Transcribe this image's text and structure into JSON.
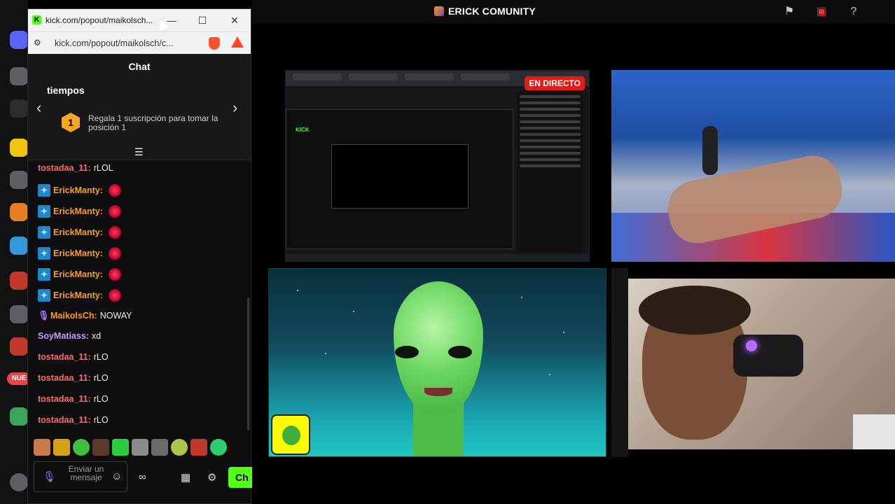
{
  "window": {
    "title": "kick.com/popout/maikolsch...",
    "url": "kick.com/popout/maikolsch/c..."
  },
  "chat": {
    "header": "Chat",
    "promo_heading": "tiempos",
    "promo_rank": "1",
    "promo_text": "Regala 1 suscripción para tomar la posición 1",
    "messages": [
      {
        "user": "tostadaa_11",
        "text": "rLOL",
        "badge": false,
        "emote": false,
        "style": "red"
      },
      {
        "user": "ErickManty",
        "text": "",
        "badge": true,
        "emote": true,
        "style": "orange"
      },
      {
        "user": "ErickManty",
        "text": "",
        "badge": true,
        "emote": true,
        "style": "orange"
      },
      {
        "user": "ErickManty",
        "text": "",
        "badge": true,
        "emote": true,
        "style": "orange"
      },
      {
        "user": "ErickManty",
        "text": "",
        "badge": true,
        "emote": true,
        "style": "orange"
      },
      {
        "user": "ErickManty",
        "text": "",
        "badge": true,
        "emote": true,
        "style": "orange"
      },
      {
        "user": "ErickManty",
        "text": "",
        "badge": true,
        "emote": true,
        "style": "orange"
      },
      {
        "user": "MaikolsCh",
        "text": "NOWAY",
        "badge": false,
        "mic": true,
        "emote": false,
        "style": "orange"
      },
      {
        "user": "SoyMatiass",
        "text": "xd",
        "badge": false,
        "emote": false,
        "style": "purple"
      },
      {
        "user": "tostadaa_11",
        "text": "rLO",
        "badge": false,
        "emote": false,
        "style": "red"
      },
      {
        "user": "tostadaa_11",
        "text": "rLO",
        "badge": false,
        "emote": false,
        "style": "red"
      },
      {
        "user": "tostadaa_11",
        "text": "rLO",
        "badge": false,
        "emote": false,
        "style": "red"
      },
      {
        "user": "tostadaa_11",
        "text": "rLO",
        "badge": false,
        "emote": false,
        "style": "red"
      }
    ],
    "input_placeholder": "Enviar un mensaje",
    "send_label": "Ch"
  },
  "stream": {
    "channel_title": "ERICK COMUNITY",
    "live_label": "EN DIRECTO"
  },
  "sidebar": {
    "badge_label": "NUE"
  },
  "colors": {
    "kick_green": "#53fc18",
    "live_red": "#e91916",
    "username_orange": "#ff9f1a"
  },
  "icons": [
    "flag-icon",
    "screen-icon",
    "help-icon",
    "close-icon",
    "minimize-icon",
    "maximize-icon",
    "smile-icon",
    "gear-icon",
    "store-icon",
    "mic-icon"
  ]
}
